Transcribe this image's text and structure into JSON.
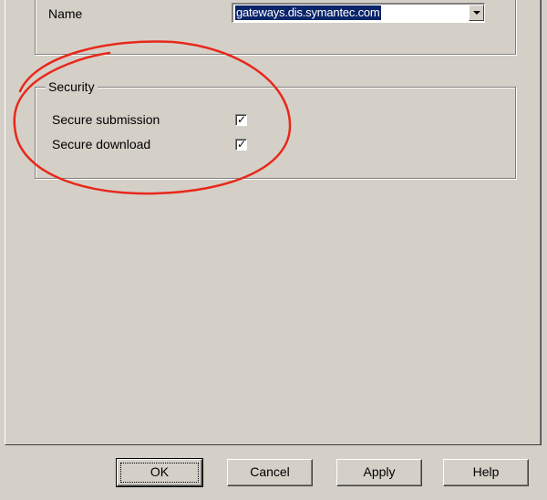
{
  "server": {
    "name_label": "Name",
    "name_value": "gateways.dis.symantec.com"
  },
  "security": {
    "legend": "Security",
    "items": [
      {
        "label": "Secure submission",
        "checked": true
      },
      {
        "label": "Secure download",
        "checked": true
      }
    ]
  },
  "buttons": {
    "ok": "OK",
    "cancel": "Cancel",
    "apply": "Apply",
    "help": "Help"
  },
  "annotation": {
    "color": "#e8281a"
  }
}
